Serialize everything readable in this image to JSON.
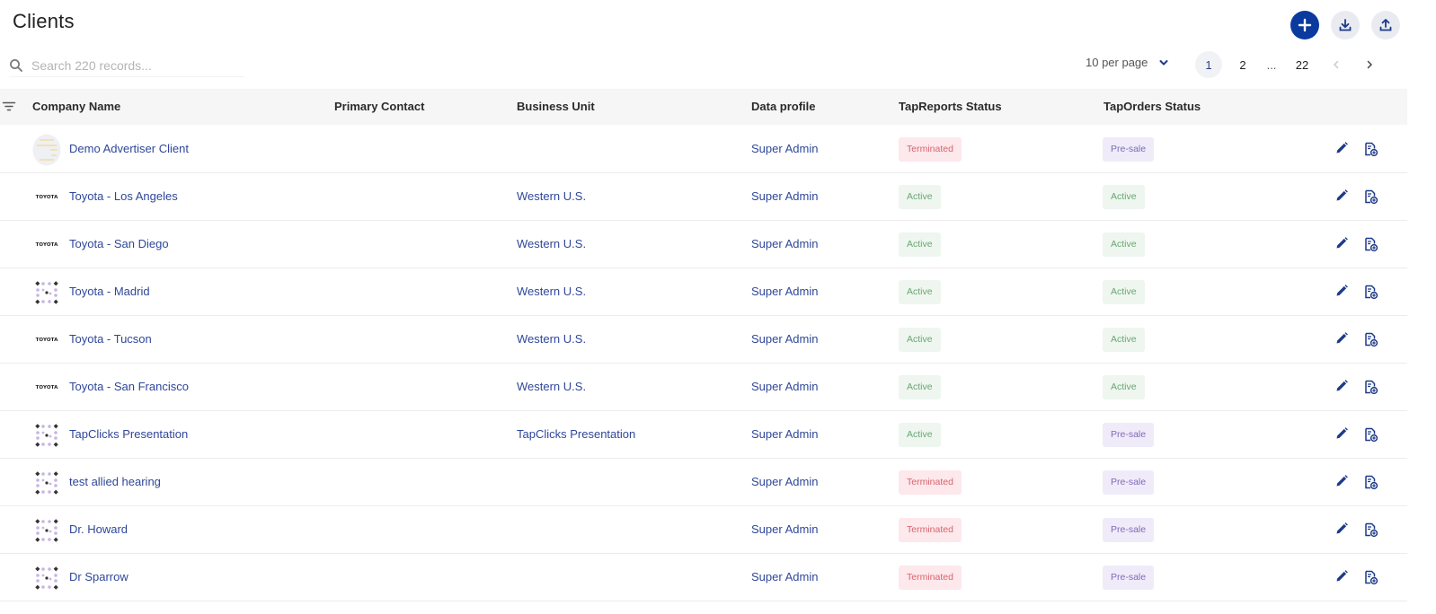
{
  "page": {
    "title": "Clients"
  },
  "actions": {
    "add": "plus-icon",
    "download": "download-icon",
    "upload": "upload-icon"
  },
  "search": {
    "placeholder": "Search 220 records..."
  },
  "pagination": {
    "per_page": "10 per page",
    "pages": [
      "1",
      "2",
      "...",
      "22"
    ],
    "current": "1"
  },
  "table": {
    "headers": [
      "Company Name",
      "Primary Contact",
      "Business Unit",
      "Data profile",
      "TapReports Status",
      "TapOrders Status"
    ],
    "rows": [
      {
        "logo": "demo-logo",
        "name": "Demo Advertiser Client",
        "contact": "",
        "business_unit": "",
        "data_profile": "Super Admin",
        "tapreports": "Terminated",
        "taporders": "Pre-sale"
      },
      {
        "logo": "toyota-logo",
        "logo_text": "TOYOTA",
        "name": "Toyota - Los Angeles",
        "contact": "",
        "business_unit": "Western U.S.",
        "data_profile": "Super Admin",
        "tapreports": "Active",
        "taporders": "Active"
      },
      {
        "logo": "toyota-logo",
        "logo_text": "TOYOTA",
        "name": "Toyota - San Diego",
        "contact": "",
        "business_unit": "Western U.S.",
        "data_profile": "Super Admin",
        "tapreports": "Active",
        "taporders": "Active"
      },
      {
        "logo": "tapclicks-logo",
        "name": "Toyota - Madrid",
        "contact": "",
        "business_unit": "Western U.S.",
        "data_profile": "Super Admin",
        "tapreports": "Active",
        "taporders": "Active"
      },
      {
        "logo": "toyota-logo",
        "logo_text": "TOYOTA",
        "name": "Toyota - Tucson",
        "contact": "",
        "business_unit": "Western U.S.",
        "data_profile": "Super Admin",
        "tapreports": "Active",
        "taporders": "Active"
      },
      {
        "logo": "toyota-logo",
        "logo_text": "TOYOTA",
        "name": "Toyota - San Francisco",
        "contact": "",
        "business_unit": "Western U.S.",
        "data_profile": "Super Admin",
        "tapreports": "Active",
        "taporders": "Active"
      },
      {
        "logo": "tapclicks-logo",
        "name": "TapClicks Presentation",
        "contact": "",
        "business_unit": "TapClicks Presentation",
        "data_profile": "Super Admin",
        "tapreports": "Active",
        "taporders": "Pre-sale"
      },
      {
        "logo": "tapclicks-logo",
        "name": "test allied hearing",
        "contact": "",
        "business_unit": "",
        "data_profile": "Super Admin",
        "tapreports": "Terminated",
        "taporders": "Pre-sale"
      },
      {
        "logo": "tapclicks-logo",
        "name": "Dr. Howard",
        "contact": "",
        "business_unit": "",
        "data_profile": "Super Admin",
        "tapreports": "Terminated",
        "taporders": "Pre-sale"
      },
      {
        "logo": "tapclicks-logo",
        "name": "Dr Sparrow",
        "contact": "",
        "business_unit": "",
        "data_profile": "Super Admin",
        "tapreports": "Terminated",
        "taporders": "Pre-sale"
      }
    ]
  },
  "colors": {
    "primary": "#0b3a9e",
    "link": "#2f4799",
    "active_bg": "#eef6ef",
    "terminated_bg": "#fde8ec",
    "presale_bg": "#f0ebf9"
  }
}
